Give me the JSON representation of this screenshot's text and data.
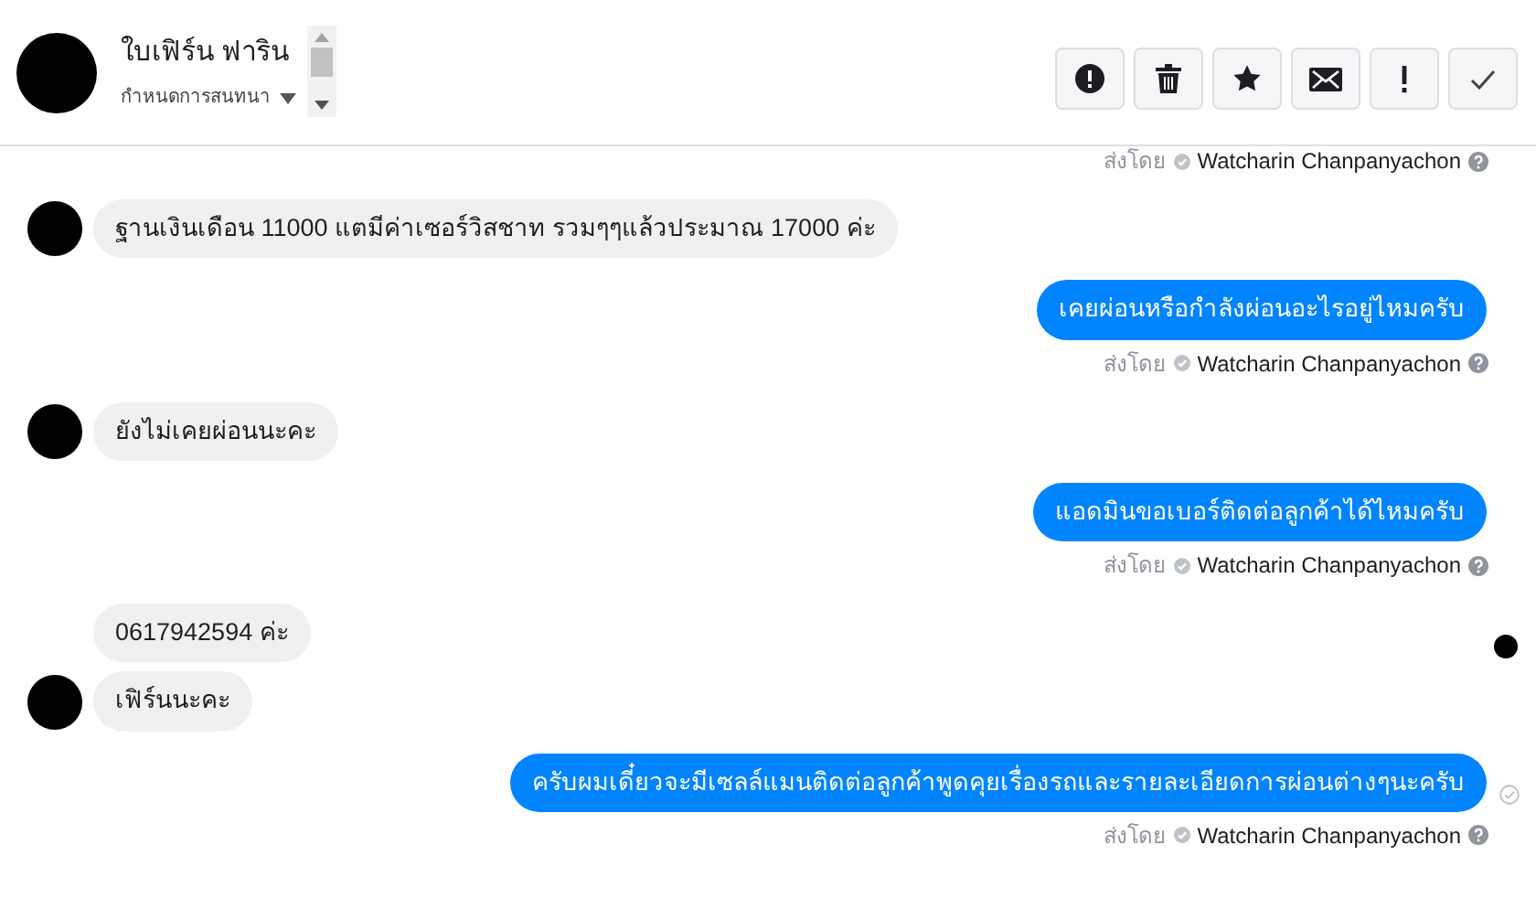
{
  "header": {
    "name": "ใบเฟิร์น ฟาริน",
    "subtitle": "กำหนดการสนทนา",
    "actions": [
      {
        "kind": "alert"
      },
      {
        "kind": "trash"
      },
      {
        "kind": "star"
      },
      {
        "kind": "mail"
      },
      {
        "kind": "exclaim"
      },
      {
        "kind": "check"
      }
    ]
  },
  "messages": [
    {
      "kind": "sender",
      "prefix": "ส่งโดย",
      "name": "Watcharin Chanpanyachon"
    },
    {
      "kind": "incoming",
      "text": "ฐานเงินเดือน 11000 แตมีค่าเซอร์วิสชาท รวมๆๆแล้วประมาณ 17000 ค่ะ",
      "avatar": true,
      "typing": false
    },
    {
      "kind": "outgoing",
      "text": "เคยผ่อนหรือกำลังผ่อนอะไรอยู่ไหมครับ",
      "seen": false
    },
    {
      "kind": "sender",
      "prefix": "ส่งโดย",
      "name": "Watcharin Chanpanyachon"
    },
    {
      "kind": "incoming",
      "text": "ยังไม่เคยผ่อนนะคะ",
      "avatar": true,
      "typing": false
    },
    {
      "kind": "outgoing",
      "text": "แอดมินขอเบอร์ติดต่อลูกค้าได้ไหมครับ",
      "seen": false
    },
    {
      "kind": "sender",
      "prefix": "ส่งโดย",
      "name": "Watcharin Chanpanyachon"
    },
    {
      "kind": "incoming",
      "text": "0617942594 ค่ะ",
      "avatar": false,
      "typing": false
    },
    {
      "kind": "incoming",
      "text": "เฟิร์นนะคะ",
      "avatar": true,
      "typing": true
    },
    {
      "kind": "outgoing",
      "text": "ครับผมเดี๋ยวจะมีเซลล์แมนติดต่อลูกค้าพูดคุยเรื่องรถและรายละเอียดการผ่อนต่างๆนะครับ",
      "seen": true
    },
    {
      "kind": "sender",
      "prefix": "ส่งโดย",
      "name": "Watcharin Chanpanyachon"
    }
  ]
}
